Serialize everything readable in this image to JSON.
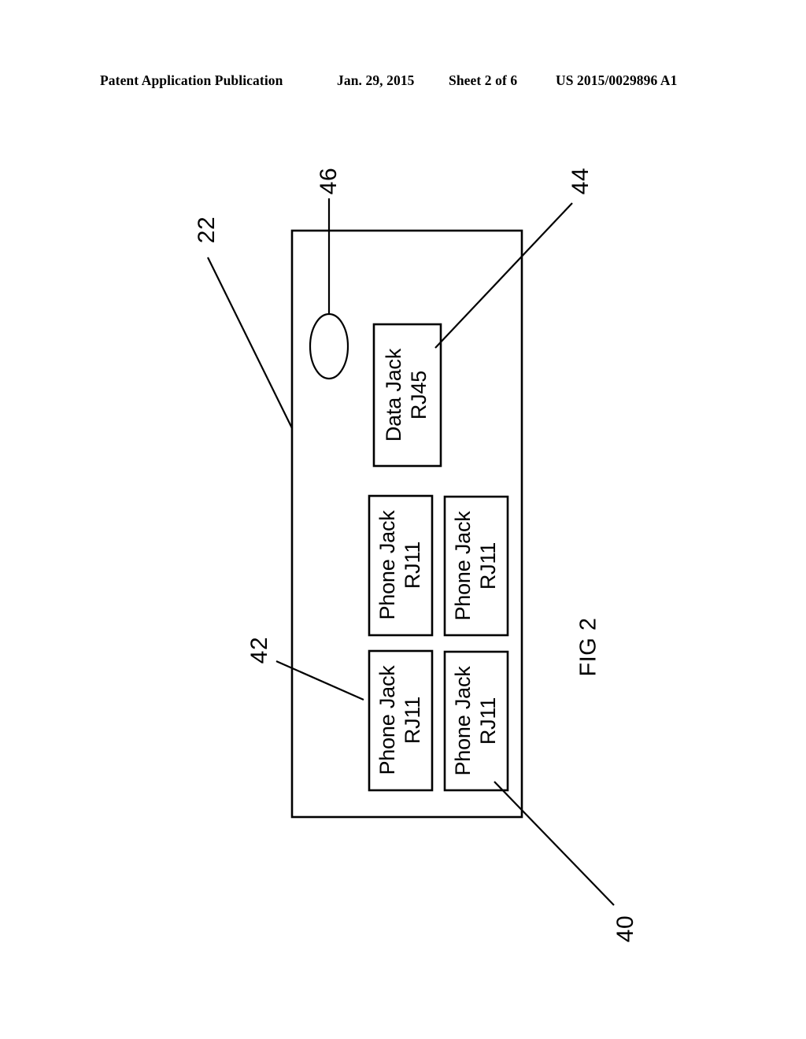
{
  "header": {
    "publication": "Patent Application Publication",
    "date": "Jan. 29, 2015",
    "sheet": "Sheet 2 of 6",
    "publication_number": "US 2015/0029896 A1"
  },
  "figure": {
    "caption": "FIG 2",
    "enclosure_label": "22",
    "components": [
      {
        "id": "data-jack",
        "line1": "Data Jack",
        "line2": "RJ45",
        "ref": "44"
      },
      {
        "id": "phone-jack-top-left",
        "line1": "Phone Jack",
        "line2": "RJ11",
        "ref": "42"
      },
      {
        "id": "phone-jack-top-right",
        "line1": "Phone Jack",
        "line2": "RJ11",
        "ref": ""
      },
      {
        "id": "phone-jack-bottom-left",
        "line1": "Phone Jack",
        "line2": "RJ11",
        "ref": ""
      },
      {
        "id": "phone-jack-bottom-right",
        "line1": "Phone Jack",
        "line2": "RJ11",
        "ref": "40"
      }
    ],
    "reference_numerals": [
      {
        "name": "enclosure",
        "value": "22"
      },
      {
        "name": "indicator",
        "value": "46"
      },
      {
        "name": "data-jack",
        "value": "44"
      },
      {
        "name": "phone-jack-group",
        "value": "42"
      },
      {
        "name": "phone-jack-unit",
        "value": "40"
      }
    ],
    "indicator": {
      "shape": "ellipse",
      "ref": "46"
    },
    "colors": {
      "line": "#000000",
      "background": "#ffffff"
    }
  }
}
